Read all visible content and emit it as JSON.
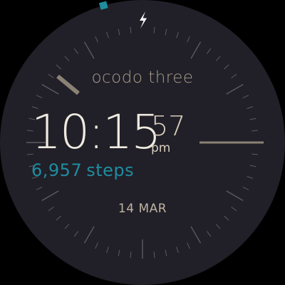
{
  "watch": {
    "brand": "ocodo three",
    "time": "10:15",
    "seconds": "57",
    "period": "pm",
    "steps_value": "6,957",
    "steps_unit": "steps",
    "date": "14 MAR",
    "battery_fill": 0.15
  },
  "icons": {
    "charging": "lightning-bolt-icon"
  },
  "colors": {
    "dial": "#211f28",
    "accent": "#1e8d9f",
    "hand": "#8a8274",
    "tick": "#5d5a5f",
    "text": "#efeadf"
  }
}
